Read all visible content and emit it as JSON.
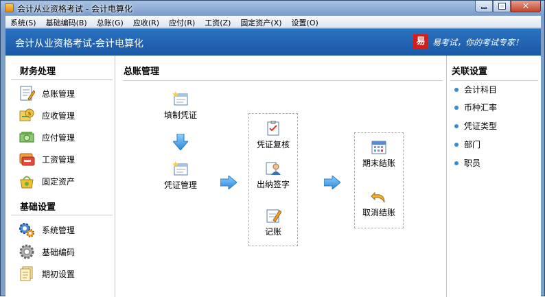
{
  "window": {
    "title": "会计从业资格考试 - 会计电算化"
  },
  "menu": [
    "系统(S)",
    "基础编码(B)",
    "总账(G)",
    "应收(R)",
    "应付(R)",
    "工资(Z)",
    "固定资产(X)",
    "设置(O)"
  ],
  "banner": {
    "title": "会计从业资格考试-会计电算化",
    "logo_char": "易",
    "slogan": "易考试，你的考试专家！"
  },
  "sidebar": {
    "finance_title": "财务处理",
    "finance_items": [
      {
        "label": "总账管理",
        "icon": "ledger-icon"
      },
      {
        "label": "应收管理",
        "icon": "receivable-icon"
      },
      {
        "label": "应付管理",
        "icon": "payable-icon"
      },
      {
        "label": "工资管理",
        "icon": "payroll-icon"
      },
      {
        "label": "固定资产",
        "icon": "fixed-assets-icon"
      }
    ],
    "basic_title": "基础设置",
    "basic_items": [
      {
        "label": "系统管理",
        "icon": "gears-icon"
      },
      {
        "label": "基础编码",
        "icon": "gear-icon"
      },
      {
        "label": "期初设置",
        "icon": "documents-icon"
      }
    ]
  },
  "main": {
    "title": "总账管理",
    "flow": {
      "fill_voucher": "填制凭证",
      "manage_voucher": "凭证管理",
      "review_voucher": "凭证复核",
      "cashier_sign": "出纳签字",
      "bookkeeping": "记账",
      "period_close": "期末结账",
      "cancel_close": "取消结账"
    }
  },
  "related": {
    "title": "关联设置",
    "links": [
      "会计科目",
      "币种汇率",
      "凭证类型",
      "部门",
      "职员"
    ]
  },
  "colors": {
    "banner": "#1f63b3",
    "arrow": "#3a9be0",
    "bullet": "#3b8ad6"
  }
}
